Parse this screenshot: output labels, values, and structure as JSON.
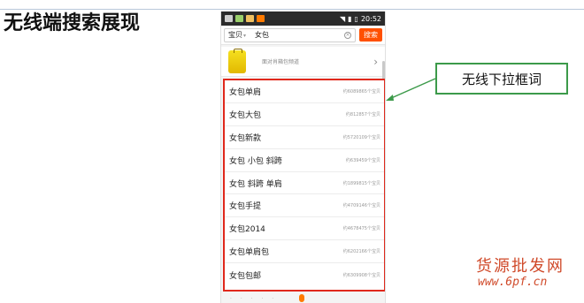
{
  "slide": {
    "title": "无线端搜索展现",
    "callout_label": "无线下拉框词",
    "watermark_cn": "货源批发网",
    "watermark_url": "www.6pf.cn"
  },
  "status_bar": {
    "time": "20:52"
  },
  "search": {
    "scope": "宝贝",
    "query": "女包",
    "button": "搜索"
  },
  "banner": {
    "text": "面对肖箱包频道",
    "image_icon": "yellow-suitcase-icon",
    "arrow_icon": "chevron-right-icon"
  },
  "suggestions": [
    {
      "label": "女包单肩",
      "count": "约6089865个宝贝"
    },
    {
      "label": "女包大包",
      "count": "约812857个宝贝"
    },
    {
      "label": "女包新款",
      "count": "约5720109个宝贝"
    },
    {
      "label": "女包 小包 斜跨",
      "count": "约639459个宝贝"
    },
    {
      "label": "女包 斜跨 单肩",
      "count": "约1899815个宝贝"
    },
    {
      "label": "女包手提",
      "count": "约4709146个宝贝"
    },
    {
      "label": "女包2014",
      "count": "约4678475个宝贝"
    },
    {
      "label": "女包单肩包",
      "count": "约6202166个宝贝"
    },
    {
      "label": "女包包邮",
      "count": "约6309908个宝贝"
    }
  ],
  "colors": {
    "highlight_border": "#e0281c",
    "callout_border": "#3c9a4a",
    "search_button": "#ff5000",
    "watermark": "#d04a2a"
  }
}
